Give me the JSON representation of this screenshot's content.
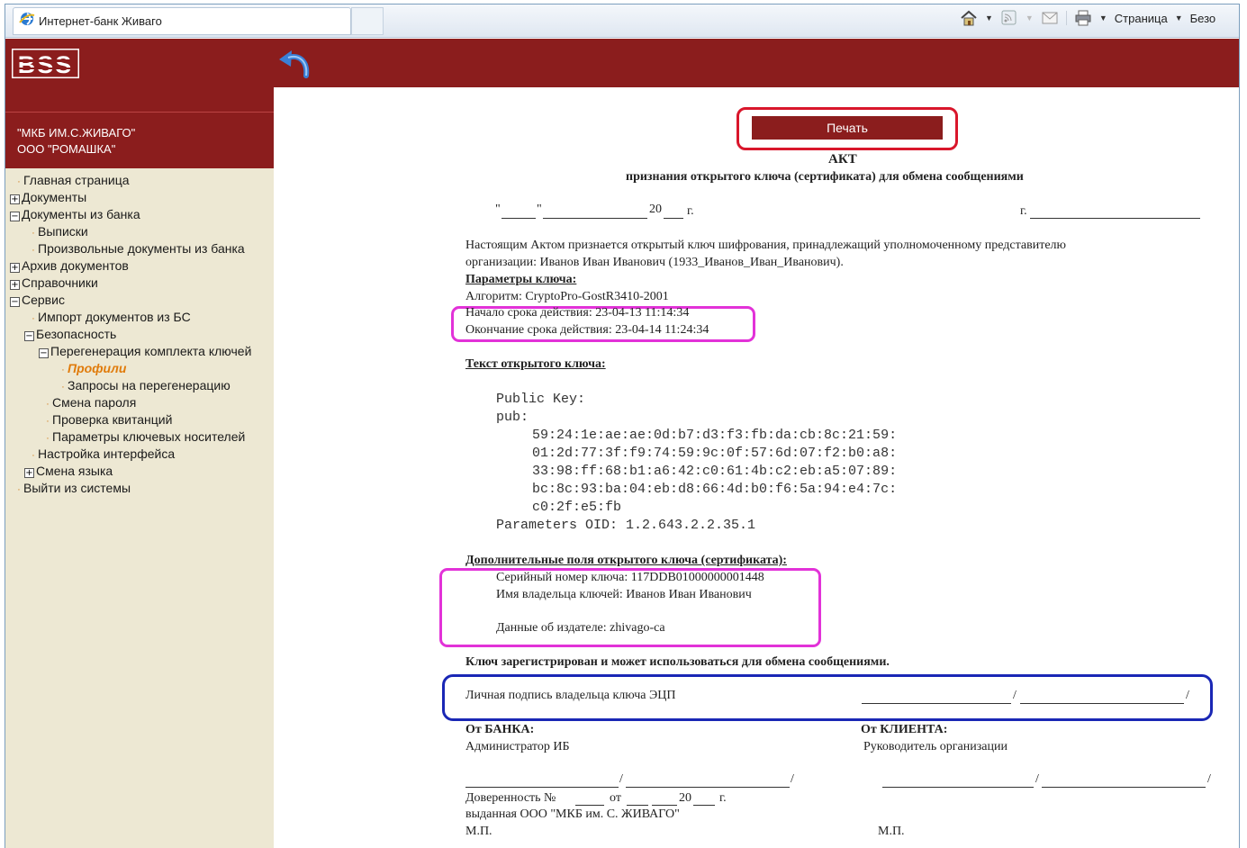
{
  "browser": {
    "tab_title": "Интернет-банк Живаго",
    "toolbar_page": "Страница",
    "toolbar_security": "Безо"
  },
  "sidebar": {
    "org_line1": "\"МКБ ИМ.С.ЖИВАГО\"",
    "org_line2": "ООО \"РОМАШКА\"",
    "items": [
      {
        "label": "Главная страница"
      },
      {
        "label": "Документы"
      },
      {
        "label": "Документы из банка"
      },
      {
        "label": "Выписки"
      },
      {
        "label": "Произвольные документы из банка"
      },
      {
        "label": "Архив документов"
      },
      {
        "label": "Справочники"
      },
      {
        "label": "Сервис"
      },
      {
        "label": "Импорт документов из БС"
      },
      {
        "label": "Безопасность"
      },
      {
        "label": "Перегенерация комплекта ключей"
      },
      {
        "label": "Профили"
      },
      {
        "label": "Запросы на перегенерацию"
      },
      {
        "label": "Смена пароля"
      },
      {
        "label": "Проверка квитанций"
      },
      {
        "label": "Параметры ключевых носителей"
      },
      {
        "label": "Настройка интерфейса"
      },
      {
        "label": "Смена языка"
      },
      {
        "label": "Выйти из системы"
      }
    ]
  },
  "document": {
    "print_button": "Печать",
    "title": "АКТ",
    "subtitle": "признания открытого ключа (сертификата) для обмена сообщениями",
    "date_quote_open": "\"",
    "date_quote_close": "\"",
    "date_year": "20",
    "date_g": "г.",
    "city_g": "г.",
    "intro_1": "Настоящим Актом признается открытый ключ шифрования, принадлежащий уполномоченному представителю",
    "intro_2": "организации: Иванов Иван Иванович (1933_Иванов_Иван_Иванович).",
    "params_heading": "Параметры ключа:",
    "algorithm": "Алгоритм: CryptoPro-GostR3410-2001",
    "valid_from": "Начало срока действия: 23-04-13 11:14:34",
    "valid_to": "Окончание срока действия: 23-04-14 11:24:34",
    "key_text_heading": "Текст открытого ключа:",
    "key_lines": [
      "Public Key:",
      "pub:",
      "59:24:1e:ae:ae:0d:b7:d3:f3:fb:da:cb:8c:21:59:",
      "01:2d:77:3f:f9:74:59:9c:0f:57:6d:07:f2:b0:a8:",
      "33:98:ff:68:b1:a6:42:c0:61:4b:c2:eb:a5:07:89:",
      "bc:8c:93:ba:04:eb:d8:66:4d:b0:f6:5a:94:e4:7c:",
      "c0:2f:e5:fb",
      "Parameters OID: 1.2.643.2.2.35.1"
    ],
    "extra_heading": "Дополнительные поля открытого ключа (сертификата):",
    "serial": "Серийный номер ключа: 117DDB01000000001448",
    "owner": "Имя владельца ключей: Иванов Иван Иванович",
    "issuer": "Данные об издателе: zhivago-ca",
    "registered": "Ключ зарегистрирован и может использоваться для обмена сообщениями.",
    "signature_label": "Личная подпись владельца ключа ЭЦП",
    "from_bank": "От БАНКА:",
    "bank_role": "Администратор ИБ",
    "from_client": "От КЛИЕНТА:",
    "client_role": "Руководитель организации",
    "poa_no": "Доверенность №",
    "poa_from": "от",
    "poa_year": "20",
    "poa_g": "г.",
    "poa_issued": "выданная ООО \"МКБ им. С. ЖИВАГО\"",
    "stamp_bank": "М.П.",
    "stamp_client": "М.П."
  }
}
